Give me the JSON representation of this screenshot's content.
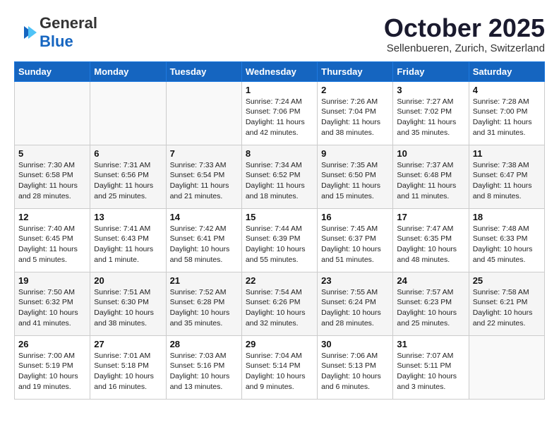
{
  "header": {
    "logo_general": "General",
    "logo_blue": "Blue",
    "month_title": "October 2025",
    "location": "Sellenbueren, Zurich, Switzerland"
  },
  "days_of_week": [
    "Sunday",
    "Monday",
    "Tuesday",
    "Wednesday",
    "Thursday",
    "Friday",
    "Saturday"
  ],
  "weeks": [
    [
      {
        "day": "",
        "info": ""
      },
      {
        "day": "",
        "info": ""
      },
      {
        "day": "",
        "info": ""
      },
      {
        "day": "1",
        "info": "Sunrise: 7:24 AM\nSunset: 7:06 PM\nDaylight: 11 hours\nand 42 minutes."
      },
      {
        "day": "2",
        "info": "Sunrise: 7:26 AM\nSunset: 7:04 PM\nDaylight: 11 hours\nand 38 minutes."
      },
      {
        "day": "3",
        "info": "Sunrise: 7:27 AM\nSunset: 7:02 PM\nDaylight: 11 hours\nand 35 minutes."
      },
      {
        "day": "4",
        "info": "Sunrise: 7:28 AM\nSunset: 7:00 PM\nDaylight: 11 hours\nand 31 minutes."
      }
    ],
    [
      {
        "day": "5",
        "info": "Sunrise: 7:30 AM\nSunset: 6:58 PM\nDaylight: 11 hours\nand 28 minutes."
      },
      {
        "day": "6",
        "info": "Sunrise: 7:31 AM\nSunset: 6:56 PM\nDaylight: 11 hours\nand 25 minutes."
      },
      {
        "day": "7",
        "info": "Sunrise: 7:33 AM\nSunset: 6:54 PM\nDaylight: 11 hours\nand 21 minutes."
      },
      {
        "day": "8",
        "info": "Sunrise: 7:34 AM\nSunset: 6:52 PM\nDaylight: 11 hours\nand 18 minutes."
      },
      {
        "day": "9",
        "info": "Sunrise: 7:35 AM\nSunset: 6:50 PM\nDaylight: 11 hours\nand 15 minutes."
      },
      {
        "day": "10",
        "info": "Sunrise: 7:37 AM\nSunset: 6:48 PM\nDaylight: 11 hours\nand 11 minutes."
      },
      {
        "day": "11",
        "info": "Sunrise: 7:38 AM\nSunset: 6:47 PM\nDaylight: 11 hours\nand 8 minutes."
      }
    ],
    [
      {
        "day": "12",
        "info": "Sunrise: 7:40 AM\nSunset: 6:45 PM\nDaylight: 11 hours\nand 5 minutes."
      },
      {
        "day": "13",
        "info": "Sunrise: 7:41 AM\nSunset: 6:43 PM\nDaylight: 11 hours\nand 1 minute."
      },
      {
        "day": "14",
        "info": "Sunrise: 7:42 AM\nSunset: 6:41 PM\nDaylight: 10 hours\nand 58 minutes."
      },
      {
        "day": "15",
        "info": "Sunrise: 7:44 AM\nSunset: 6:39 PM\nDaylight: 10 hours\nand 55 minutes."
      },
      {
        "day": "16",
        "info": "Sunrise: 7:45 AM\nSunset: 6:37 PM\nDaylight: 10 hours\nand 51 minutes."
      },
      {
        "day": "17",
        "info": "Sunrise: 7:47 AM\nSunset: 6:35 PM\nDaylight: 10 hours\nand 48 minutes."
      },
      {
        "day": "18",
        "info": "Sunrise: 7:48 AM\nSunset: 6:33 PM\nDaylight: 10 hours\nand 45 minutes."
      }
    ],
    [
      {
        "day": "19",
        "info": "Sunrise: 7:50 AM\nSunset: 6:32 PM\nDaylight: 10 hours\nand 41 minutes."
      },
      {
        "day": "20",
        "info": "Sunrise: 7:51 AM\nSunset: 6:30 PM\nDaylight: 10 hours\nand 38 minutes."
      },
      {
        "day": "21",
        "info": "Sunrise: 7:52 AM\nSunset: 6:28 PM\nDaylight: 10 hours\nand 35 minutes."
      },
      {
        "day": "22",
        "info": "Sunrise: 7:54 AM\nSunset: 6:26 PM\nDaylight: 10 hours\nand 32 minutes."
      },
      {
        "day": "23",
        "info": "Sunrise: 7:55 AM\nSunset: 6:24 PM\nDaylight: 10 hours\nand 28 minutes."
      },
      {
        "day": "24",
        "info": "Sunrise: 7:57 AM\nSunset: 6:23 PM\nDaylight: 10 hours\nand 25 minutes."
      },
      {
        "day": "25",
        "info": "Sunrise: 7:58 AM\nSunset: 6:21 PM\nDaylight: 10 hours\nand 22 minutes."
      }
    ],
    [
      {
        "day": "26",
        "info": "Sunrise: 7:00 AM\nSunset: 5:19 PM\nDaylight: 10 hours\nand 19 minutes."
      },
      {
        "day": "27",
        "info": "Sunrise: 7:01 AM\nSunset: 5:18 PM\nDaylight: 10 hours\nand 16 minutes."
      },
      {
        "day": "28",
        "info": "Sunrise: 7:03 AM\nSunset: 5:16 PM\nDaylight: 10 hours\nand 13 minutes."
      },
      {
        "day": "29",
        "info": "Sunrise: 7:04 AM\nSunset: 5:14 PM\nDaylight: 10 hours\nand 9 minutes."
      },
      {
        "day": "30",
        "info": "Sunrise: 7:06 AM\nSunset: 5:13 PM\nDaylight: 10 hours\nand 6 minutes."
      },
      {
        "day": "31",
        "info": "Sunrise: 7:07 AM\nSunset: 5:11 PM\nDaylight: 10 hours\nand 3 minutes."
      },
      {
        "day": "",
        "info": ""
      }
    ]
  ]
}
